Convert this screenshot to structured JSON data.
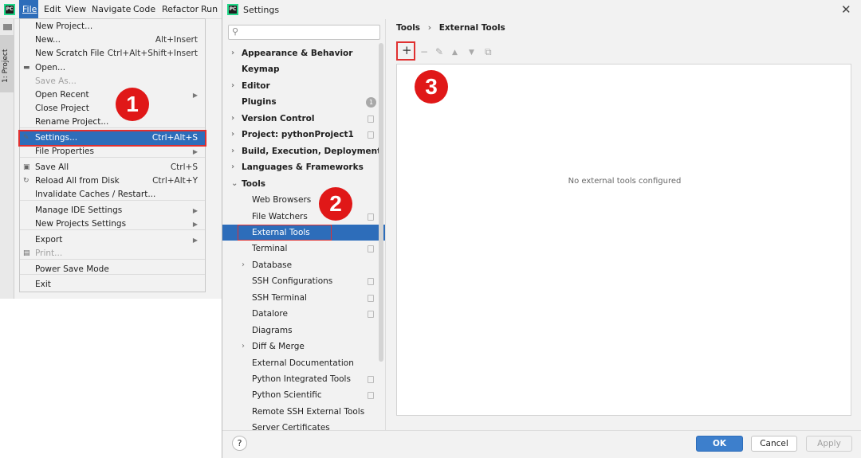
{
  "ide": {
    "menubar": [
      "File",
      "Edit",
      "View",
      "Navigate",
      "Code",
      "Refactor",
      "Run"
    ],
    "project_tab": "1: Project",
    "app_icon": "pycharm-icon"
  },
  "file_menu": [
    {
      "label": "New Project...",
      "shortcut": ""
    },
    {
      "label": "New...",
      "shortcut": "Alt+Insert"
    },
    {
      "label": "New Scratch File",
      "shortcut": "Ctrl+Alt+Shift+Insert"
    },
    {
      "label": "Open...",
      "shortcut": "",
      "icon": "folder-icon"
    },
    {
      "label": "Save As...",
      "shortcut": "",
      "disabled": true
    },
    {
      "label": "Open Recent",
      "shortcut": "",
      "submenu": true
    },
    {
      "label": "Close Project",
      "shortcut": ""
    },
    {
      "label": "Rename Project...",
      "shortcut": ""
    },
    {
      "label": "Settings...",
      "shortcut": "Ctrl+Alt+S",
      "selected": true,
      "icon": "wrench-icon"
    },
    {
      "label": "File Properties",
      "shortcut": "",
      "submenu": true
    },
    {
      "label": "Save All",
      "shortcut": "Ctrl+S",
      "icon": "save-icon"
    },
    {
      "label": "Reload All from Disk",
      "shortcut": "Ctrl+Alt+Y",
      "icon": "reload-icon"
    },
    {
      "label": "Invalidate Caches / Restart...",
      "shortcut": ""
    },
    {
      "label": "Manage IDE Settings",
      "shortcut": "",
      "submenu": true
    },
    {
      "label": "New Projects Settings",
      "shortcut": "",
      "submenu": true
    },
    {
      "label": "Export",
      "shortcut": "",
      "submenu": true
    },
    {
      "label": "Print...",
      "shortcut": "",
      "disabled": true,
      "icon": "print-icon"
    },
    {
      "label": "Power Save Mode",
      "shortcut": ""
    },
    {
      "label": "Exit",
      "shortcut": ""
    }
  ],
  "annotations": [
    "1",
    "2",
    "3"
  ],
  "settings": {
    "title": "Settings",
    "search_placeholder": "",
    "tree": [
      {
        "label": "Appearance & Behavior",
        "level": 0,
        "bold": true,
        "arrow": "right"
      },
      {
        "label": "Keymap",
        "level": 0,
        "bold": true
      },
      {
        "label": "Editor",
        "level": 0,
        "bold": true,
        "arrow": "right"
      },
      {
        "label": "Plugins",
        "level": 0,
        "bold": true,
        "badge": "1"
      },
      {
        "label": "Version Control",
        "level": 0,
        "bold": true,
        "arrow": "right",
        "project": true
      },
      {
        "label": "Project: pythonProject1",
        "level": 0,
        "bold": true,
        "arrow": "right",
        "project": true
      },
      {
        "label": "Build, Execution, Deployment",
        "level": 0,
        "bold": true,
        "arrow": "right"
      },
      {
        "label": "Languages & Frameworks",
        "level": 0,
        "bold": true,
        "arrow": "right"
      },
      {
        "label": "Tools",
        "level": 0,
        "bold": true,
        "arrow": "down"
      },
      {
        "label": "Web Browsers",
        "level": 1
      },
      {
        "label": "File Watchers",
        "level": 1,
        "project": true
      },
      {
        "label": "External Tools",
        "level": 1,
        "selected": true
      },
      {
        "label": "Terminal",
        "level": 1,
        "project": true
      },
      {
        "label": "Database",
        "level": 1,
        "arrow": "right"
      },
      {
        "label": "SSH Configurations",
        "level": 1,
        "project": true
      },
      {
        "label": "SSH Terminal",
        "level": 1,
        "project": true
      },
      {
        "label": "Datalore",
        "level": 1,
        "project": true
      },
      {
        "label": "Diagrams",
        "level": 1
      },
      {
        "label": "Diff & Merge",
        "level": 1,
        "arrow": "right"
      },
      {
        "label": "External Documentation",
        "level": 1
      },
      {
        "label": "Python Integrated Tools",
        "level": 1,
        "project": true
      },
      {
        "label": "Python Scientific",
        "level": 1,
        "project": true
      },
      {
        "label": "Remote SSH External Tools",
        "level": 1
      },
      {
        "label": "Server Certificates",
        "level": 1
      }
    ],
    "breadcrumb": [
      "Tools",
      "External Tools"
    ],
    "toolbar": {
      "add": "+",
      "remove": "−",
      "edit": "✎",
      "up": "▲",
      "down": "▼",
      "copy": "⧉"
    },
    "empty_text": "No external tools configured",
    "buttons": {
      "ok": "OK",
      "cancel": "Cancel",
      "apply": "Apply",
      "help": "?"
    },
    "colors": {
      "accent": "#2d6dba",
      "annotation": "#e01818"
    }
  }
}
